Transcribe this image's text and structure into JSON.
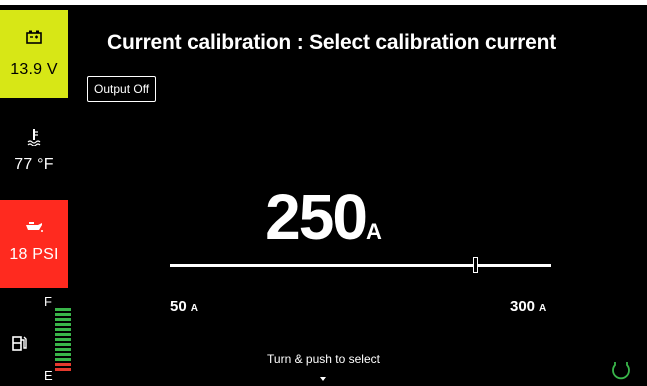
{
  "sidebar": {
    "battery": {
      "icon": "battery-icon",
      "value": "13.9 V",
      "bg": "#d7e716"
    },
    "temperature": {
      "icon": "thermometer-icon",
      "value": "77 °F"
    },
    "oil_pressure": {
      "icon": "oil-can-icon",
      "value": "18 PSI",
      "bg": "#ff2a1f"
    },
    "fuel": {
      "icon": "fuel-pump-icon",
      "full_label": "F",
      "empty_label": "E",
      "bar_colors": [
        "#39b54a",
        "#39b54a",
        "#39b54a",
        "#39b54a",
        "#39b54a",
        "#39b54a",
        "#39b54a",
        "#39b54a",
        "#39b54a",
        "#39b54a",
        "#39b54a",
        "#e53a2e",
        "#e53a2e"
      ]
    }
  },
  "header": {
    "title": "Current calibration : Select calibration current"
  },
  "output_button": {
    "label": "Output Off"
  },
  "readout": {
    "value": "250",
    "unit": "A"
  },
  "slider": {
    "min": 50,
    "max": 300,
    "value": 250,
    "min_label": "50",
    "max_label": "300",
    "unit_label": "A"
  },
  "hint": {
    "text": "Turn & push to select",
    "icon": "caret-down-icon"
  },
  "status_icon": "knob-icon",
  "colors": {
    "accent_green": "#39b54a",
    "battery_yellow": "#d7e716",
    "alert_red": "#ff2a1f"
  }
}
